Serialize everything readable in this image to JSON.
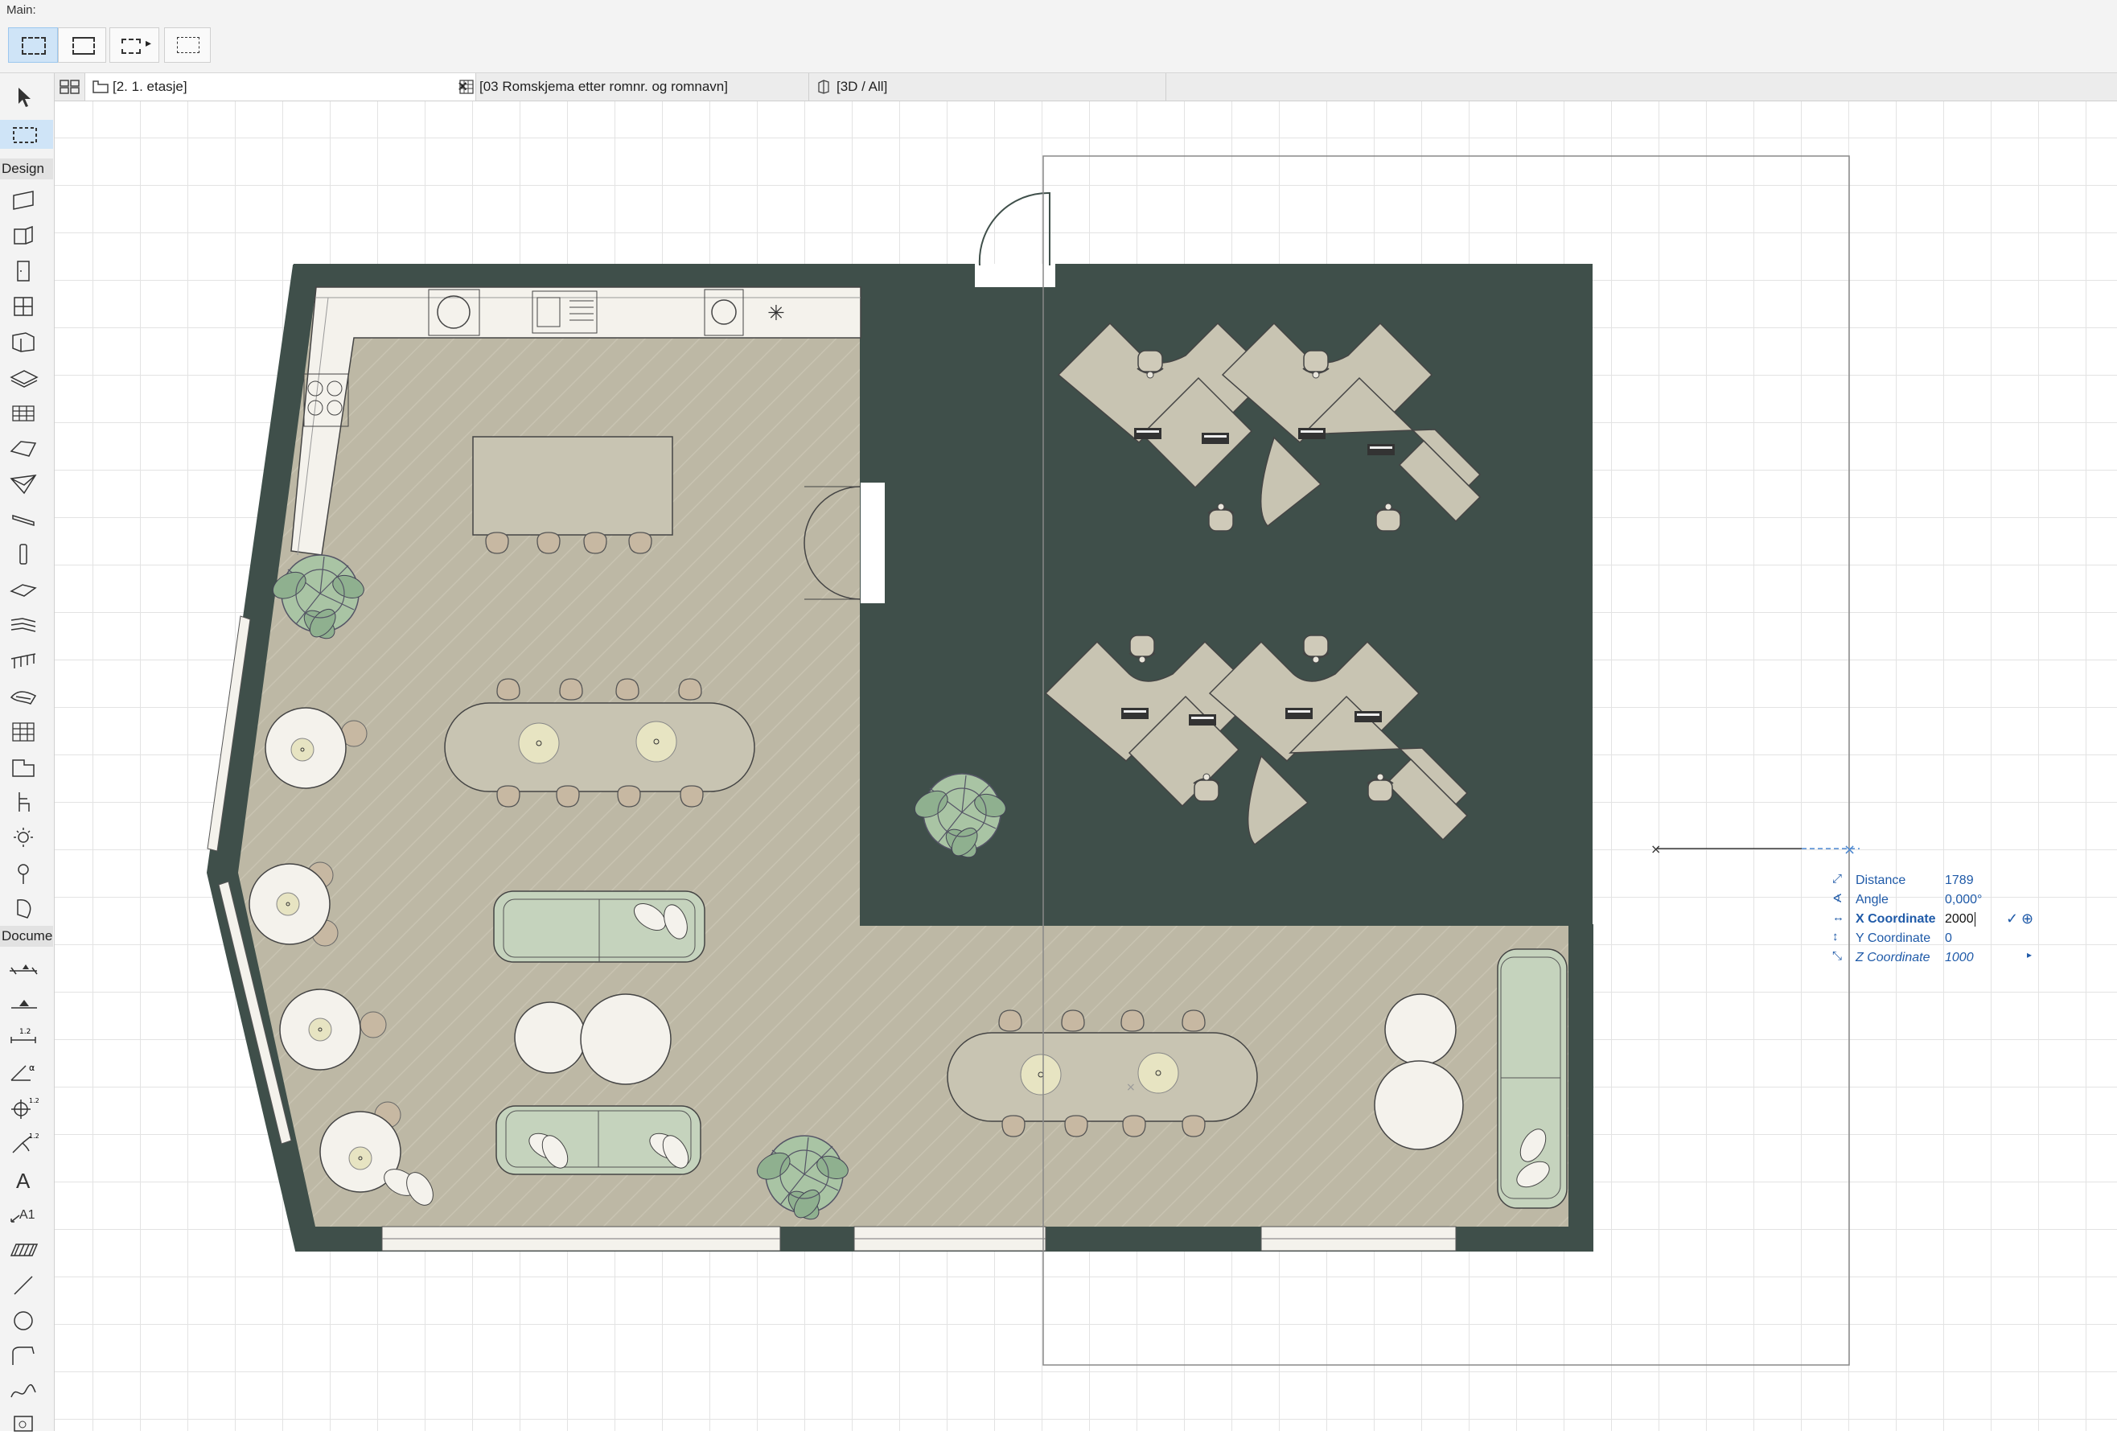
{
  "toolbar": {
    "label": "Main:"
  },
  "tabs": [
    {
      "label": "[2. 1. etasje]",
      "icon": "floor-plan-icon",
      "close": "×"
    },
    {
      "label": "[03 Romskjema etter romnr. og romnavn]",
      "icon": "schedule-icon"
    },
    {
      "label": "[3D / All]",
      "icon": "3d-view-icon"
    }
  ],
  "palette": {
    "design_label": "Design",
    "document_label": "Docume"
  },
  "tracker": {
    "distance_label": "Distance",
    "distance_value": "1789",
    "angle_label": "Angle",
    "angle_value": "0,000°",
    "x_label": "X Coordinate",
    "x_value": "2000",
    "y_label": "Y Coordinate",
    "y_value": "0",
    "z_label": "Z Coordinate",
    "z_value": "1000",
    "confirm_icon": "check-icon",
    "target_icon": "crosshair-icon"
  },
  "colors": {
    "wall": "#3f4f4a",
    "floor_main": "#bdb8a5",
    "floor_office": "#d1d2c8",
    "counter": "#f4f2ec",
    "sofa": "#c5d3bd",
    "plant": "#8fb08f",
    "table": "#c8c4b2",
    "accent_blue": "#1f5aa8",
    "active_button": "#cfe4f7"
  }
}
